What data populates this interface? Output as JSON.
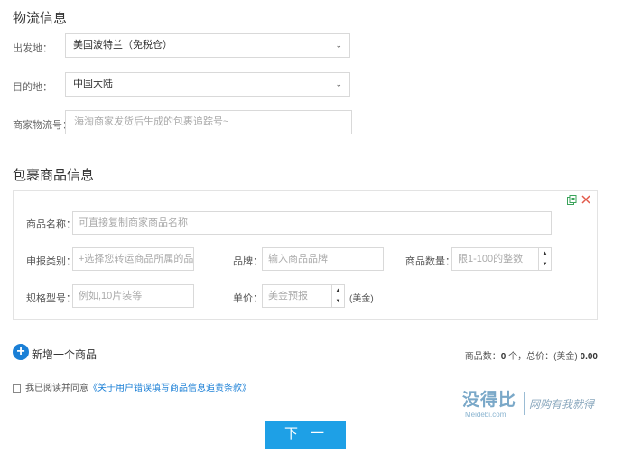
{
  "logistics": {
    "title": "物流信息",
    "origin_label": "出发地：",
    "origin_value": "美国波特兰（免税仓）",
    "dest_label": "目的地：",
    "dest_value": "中国大陆",
    "tracking_label": "商家物流号：",
    "tracking_placeholder": "海淘商家发货后生成的包裹追踪号~"
  },
  "package": {
    "title": "包裹商品信息",
    "name_label": "商品名称：",
    "name_placeholder": "可直接复制商家商品名称",
    "category_label": "申报类别：",
    "category_placeholder": "+选择您转运商品所属的品类",
    "brand_label": "品牌：",
    "brand_placeholder": "输入商品品牌",
    "quantity_label": "商品数量：",
    "quantity_placeholder": "限1-100的整数",
    "spec_label": "规格型号：",
    "spec_placeholder": "例如,10片装等",
    "price_label": "单价：",
    "price_placeholder": "美金预报",
    "price_unit": "(美金)"
  },
  "actions": {
    "add_item_label": "新增一个商品",
    "summary_count_prefix": "商品数：",
    "summary_count": "0",
    "summary_count_unit": "个，总价：(美金)",
    "summary_total": "0.00",
    "agree_prefix": "我已阅读并同意",
    "agree_link": "《关于用户错误填写商品信息追责条款》",
    "next_label": "下一步"
  },
  "watermark": {
    "main": "没得比",
    "sub": "Meidebi.com",
    "slogan": "网购有我就得",
    "colors": {
      "main": "#7aa8c8"
    }
  },
  "colors": {
    "accent": "#1a7fd6",
    "button": "#1ea0e6",
    "icon_green": "#3aa35a",
    "icon_red": "#e25a4a"
  }
}
